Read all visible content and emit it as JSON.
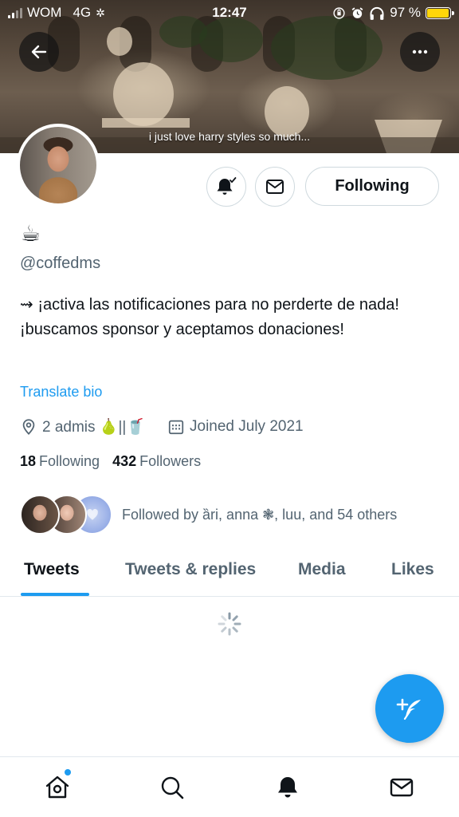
{
  "status_bar": {
    "carrier": "WOM",
    "network": "4G",
    "time": "12:47",
    "battery_text": "97 %",
    "battery_level": 0.97,
    "battery_color": "#ffd60a"
  },
  "banner": {
    "caption": "i just love harry styles so much..."
  },
  "icons": {
    "back": "arrow-left-icon",
    "more": "more-horizontal-icon",
    "notifications": "bell-check-icon",
    "message": "envelope-icon",
    "location": "location-pin-icon",
    "calendar": "calendar-icon"
  },
  "profile": {
    "display_name": "☕",
    "handle": "@coffedms",
    "bio": "⇝ ¡activa las notificaciones para no perderte de nada! ¡buscamos sponsor y aceptamos donaciones!",
    "translate_label": "Translate bio",
    "location": "2 admis 🍐||🥤",
    "joined": "Joined July 2021",
    "following_count": "18",
    "following_label": "Following",
    "followers_count": "432",
    "followers_label": "Followers",
    "followed_by": "Followed by ȁri, anna ❃, luu, and 54 others"
  },
  "actions": {
    "follow_button": "Following"
  },
  "tabs": [
    {
      "label": "Tweets",
      "active": true
    },
    {
      "label": "Tweets & replies",
      "active": false
    },
    {
      "label": "Media",
      "active": false
    },
    {
      "label": "Likes",
      "active": false
    }
  ],
  "colors": {
    "accent": "#1d9bf0",
    "text_primary": "#0f1419",
    "text_secondary": "#536471"
  },
  "bottom_nav": [
    {
      "name": "home",
      "icon": "home-icon",
      "has_badge": true
    },
    {
      "name": "search",
      "icon": "search-icon",
      "has_badge": false
    },
    {
      "name": "notifications",
      "icon": "bell-icon",
      "has_badge": false
    },
    {
      "name": "messages",
      "icon": "envelope-icon",
      "has_badge": false
    }
  ]
}
